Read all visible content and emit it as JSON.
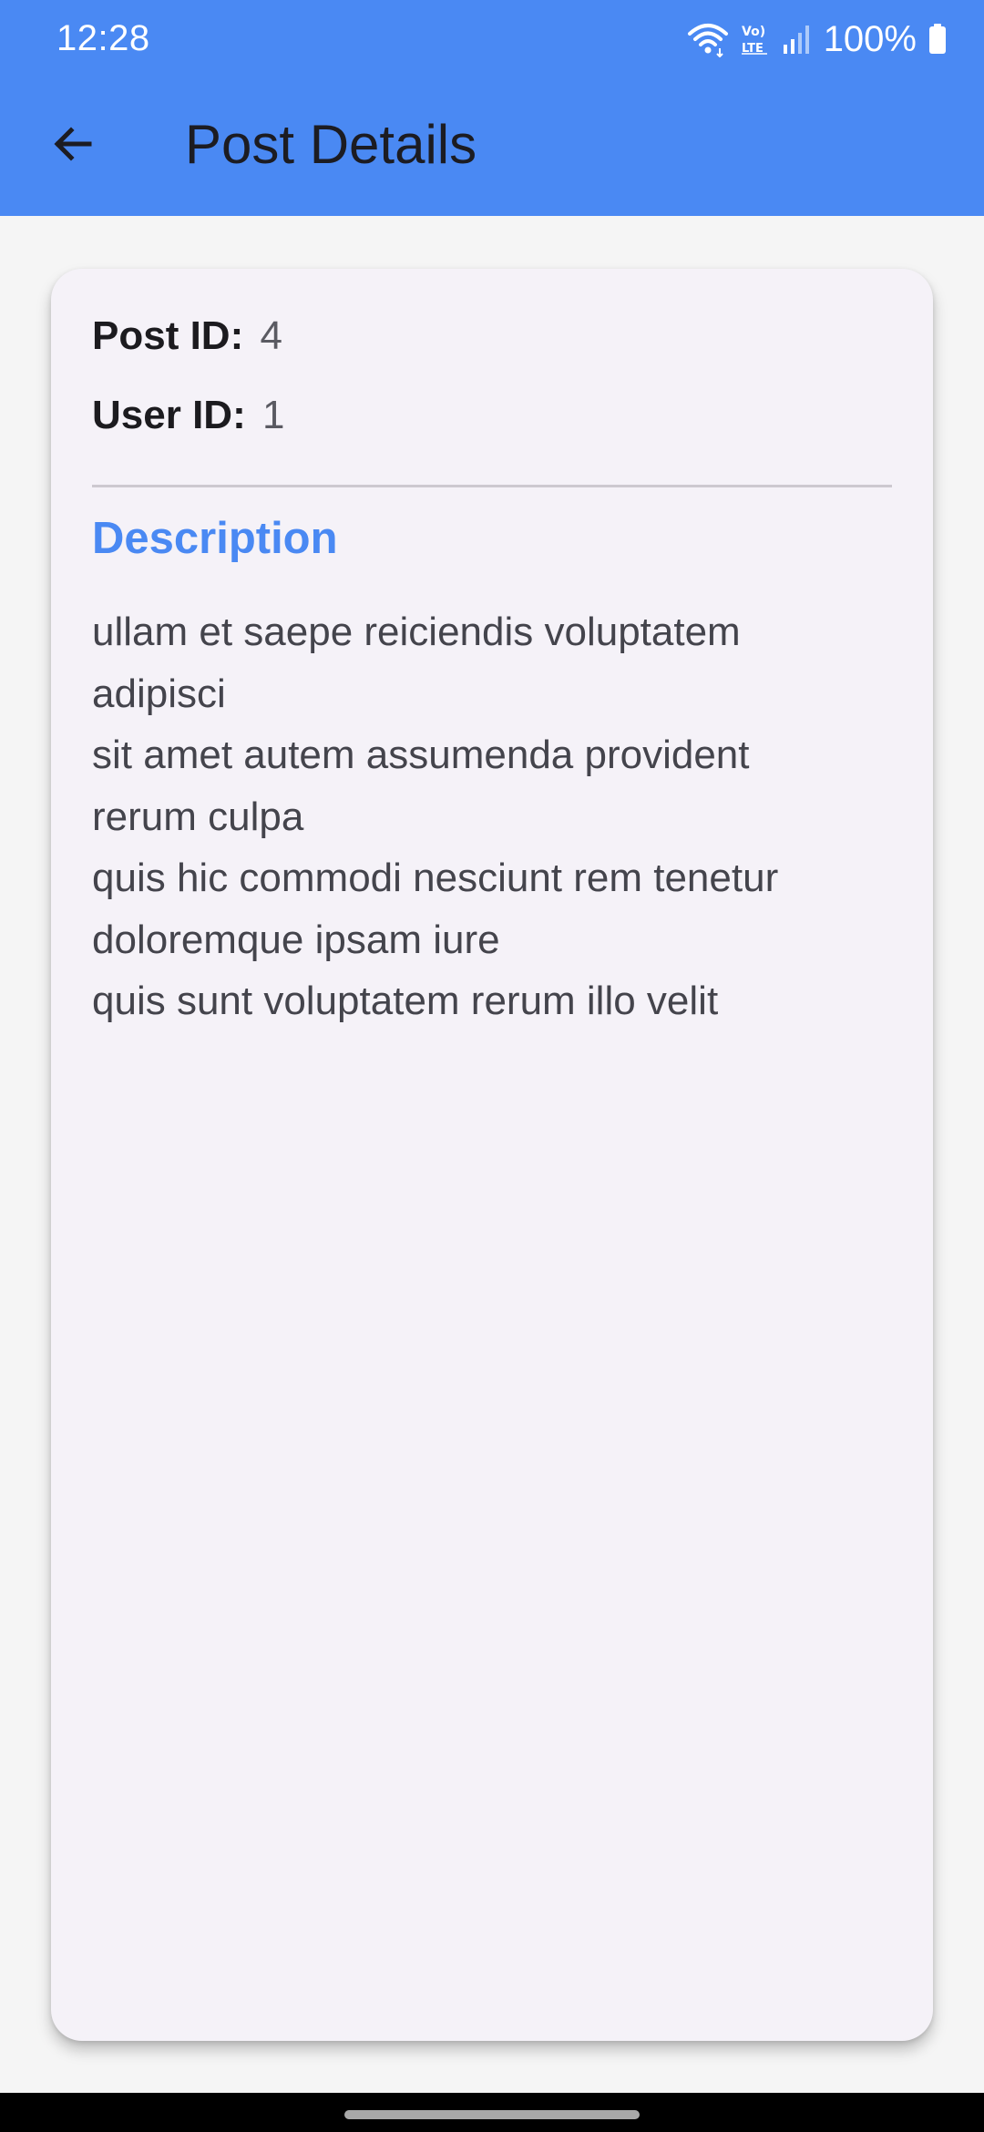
{
  "status_bar": {
    "time": "12:28",
    "battery_percent": "100%",
    "network_label": "VoLTE",
    "icons": [
      "wifi-icon",
      "volte-icon",
      "signal-icon",
      "battery-icon"
    ]
  },
  "app_bar": {
    "title": "Post Details",
    "back_icon": "arrow-back-icon",
    "background_color": "#4a89f3"
  },
  "post": {
    "post_id_label": "Post ID:",
    "post_id_value": "4",
    "user_id_label": "User ID:",
    "user_id_value": "1",
    "description_title": "Description",
    "description_body": "ullam et saepe reiciendis voluptatem\nadipisci\nsit amet autem assumenda provident\nrerum culpa\nquis hic commodi nesciunt rem tenetur\ndoloremque ipsam iure\nquis sunt voluptatem rerum illo velit"
  },
  "colors": {
    "accent": "#4a89f3",
    "card_background": "#f5f2f8",
    "page_background": "#f5f5f5"
  }
}
